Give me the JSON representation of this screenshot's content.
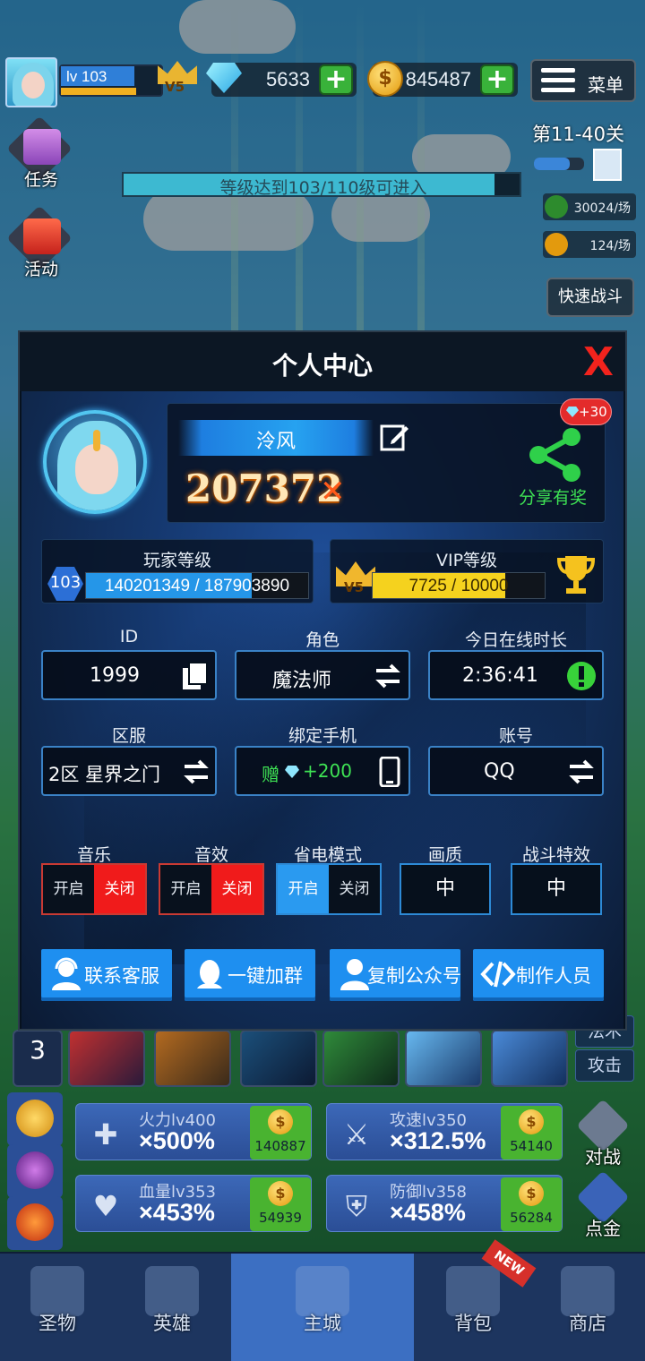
{
  "top": {
    "level": "lv 103",
    "vip": "V5",
    "gems": "5633",
    "coins": "845487",
    "plus": "+",
    "menu": "菜单"
  },
  "side": {
    "task": "任务",
    "activity": "活动"
  },
  "level_bar": "等级达到103/110级可进入",
  "level_bar_progress": 0.936,
  "stage": {
    "title": "第11-40关",
    "exp_rate": "30024/场",
    "coin_rate": "124/场",
    "fast_battle": "快速战斗"
  },
  "panel": {
    "title": "个人中心",
    "close": "X",
    "name": "泠风",
    "power": "207372",
    "share_bonus": "+30",
    "share_label": "分享有奖",
    "player_level_title": "玩家等级",
    "player_level": "103",
    "player_exp": "140201349 / 187903890",
    "player_exp_fraction": 0.746,
    "vip_title": "VIP等级",
    "vip_level": "V5",
    "vip_exp": "7725 / 10000",
    "vip_exp_fraction": 0.7725,
    "id_label": "ID",
    "id_value": "1999",
    "role_label": "角色",
    "role_value": "魔法师",
    "online_label": "今日在线时长",
    "online_value": "2:36:41",
    "server_label": "区服",
    "server_value": "2区 星界之门",
    "phone_label": "绑定手机",
    "phone_value_prefix": "赠",
    "phone_value_bonus": "+200",
    "account_label": "账号",
    "account_value": "QQ",
    "music_label": "音乐",
    "sfx_label": "音效",
    "power_save_label": "省电模式",
    "quality_label": "画质",
    "battle_fx_label": "战斗特效",
    "on": "开启",
    "off": "关闭",
    "quality_value": "中",
    "battle_fx_value": "中",
    "btn_support": "联系客服",
    "btn_group": "一键加群",
    "btn_copy": "复制公众号",
    "btn_credits": "制作人员"
  },
  "hud": {
    "skill_count": "3",
    "fa_btn": "法术",
    "attack_btn": "攻击",
    "firepower_name": "火力lv400",
    "firepower_mult": "×500%",
    "firepower_cost": "140887",
    "speed_name": "攻速lv350",
    "speed_mult": "×312.5%",
    "speed_cost": "54140",
    "hp_name": "血量lv353",
    "hp_mult": "×453%",
    "hp_cost": "54939",
    "def_name": "防御lv358",
    "def_mult": "×458%",
    "def_cost": "56284",
    "duel": "对战",
    "gold": "点金"
  },
  "nav": {
    "relic": "圣物",
    "hero": "英雄",
    "city": "主城",
    "bag": "背包",
    "shop": "商店",
    "new_tag": "NEW"
  },
  "colors": {
    "accent_blue": "#1e8ff0",
    "toggle_red": "#f01b1b",
    "share_green": "#3ee254",
    "close_red": "#f2231d"
  }
}
